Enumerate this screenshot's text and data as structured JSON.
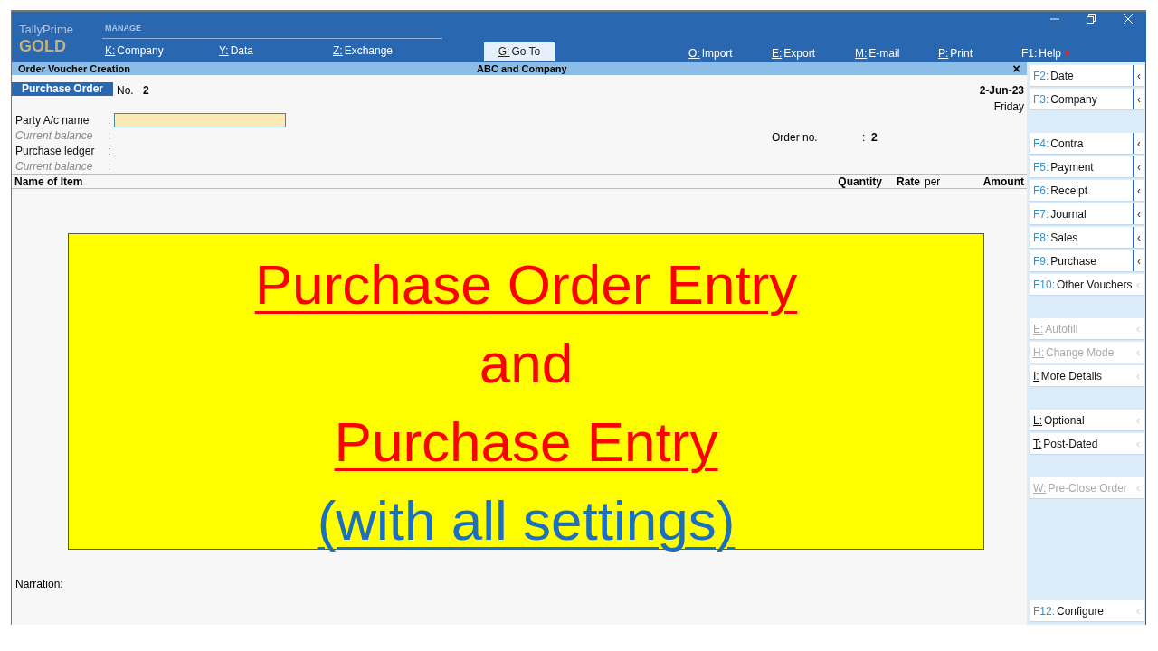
{
  "header": {
    "product": "TallyPrime",
    "edition": "GOLD",
    "section": "MANAGE",
    "menu": [
      {
        "key": "K:",
        "label": "Company"
      },
      {
        "key": "Y:",
        "label": "Data"
      },
      {
        "key": "Z:",
        "label": "Exchange"
      }
    ],
    "goto": {
      "key": "G:",
      "label": "Go To"
    },
    "right_menu": [
      {
        "key": "O:",
        "label": "Import",
        "kind": "letter"
      },
      {
        "key": "E:",
        "label": "Export",
        "kind": "letter"
      },
      {
        "key": "M:",
        "label": "E-mail",
        "kind": "letter"
      },
      {
        "key": "P:",
        "label": "Print",
        "kind": "letter"
      },
      {
        "key": "F1:",
        "label": "Help",
        "kind": "function"
      }
    ]
  },
  "title_bar": {
    "title": "Order Voucher Creation",
    "company": "ABC and Company",
    "close": "×"
  },
  "voucher": {
    "type": "Purchase Order",
    "no_label": "No.",
    "no": "2",
    "date": "2-Jun-23",
    "day": "Friday"
  },
  "fields": [
    {
      "label": "Party A/c name",
      "sep": ":",
      "kind": "input",
      "italic": false
    },
    {
      "label": "Current balance",
      "sep": ":",
      "kind": "info",
      "italic": true
    },
    {
      "label": "Purchase ledger",
      "sep": ":",
      "kind": "info",
      "italic": false
    },
    {
      "label": "Current balance",
      "sep": ":",
      "kind": "info",
      "italic": true
    }
  ],
  "order_no": {
    "label": "Order no.",
    "sep": ":",
    "value": "2"
  },
  "columns": [
    "Name of Item",
    "Quantity",
    "Rate",
    "per",
    "Amount"
  ],
  "banner": [
    {
      "text": "Purchase Order Entry",
      "color": "#ff0000",
      "underline": true
    },
    {
      "text": "and",
      "color": "#ff0000",
      "underline": false
    },
    {
      "text": "Purchase Entry",
      "color": "#ff0000",
      "underline": true
    },
    {
      "text": "(with all settings)",
      "color": "#1a6fc0",
      "underline": true
    }
  ],
  "narration": "Narration:",
  "sidebar": {
    "groups": [
      [
        {
          "key": "F2:",
          "label": "Date",
          "kind": "function",
          "disabled": false,
          "expandable": true,
          "arrow": "‹"
        },
        {
          "key": "F3:",
          "label": "Company",
          "kind": "function",
          "disabled": false,
          "expandable": true,
          "arrow": "‹"
        }
      ],
      [
        {
          "key": "F4:",
          "label": "Contra",
          "kind": "function",
          "disabled": false,
          "expandable": true,
          "arrow": "‹"
        },
        {
          "key": "F5:",
          "label": "Payment",
          "kind": "function",
          "disabled": false,
          "expandable": true,
          "arrow": "‹"
        },
        {
          "key": "F6:",
          "label": "Receipt",
          "kind": "function",
          "disabled": false,
          "expandable": true,
          "arrow": "‹"
        },
        {
          "key": "F7:",
          "label": "Journal",
          "kind": "function",
          "disabled": false,
          "expandable": true,
          "arrow": "‹"
        },
        {
          "key": "F8:",
          "label": "Sales",
          "kind": "function",
          "disabled": false,
          "expandable": true,
          "arrow": "‹"
        },
        {
          "key": "F9:",
          "label": "Purchase",
          "kind": "function",
          "disabled": false,
          "expandable": true,
          "arrow": "‹"
        },
        {
          "key": "F10:",
          "label": "Other Vouchers",
          "kind": "function",
          "disabled": false,
          "expandable": false,
          "arrow": "‹"
        }
      ],
      [
        {
          "key": "E:",
          "label": "Autofill",
          "kind": "letter",
          "disabled": true,
          "expandable": false,
          "arrow": "‹"
        },
        {
          "key": "H:",
          "label": "Change Mode",
          "kind": "letter",
          "disabled": true,
          "expandable": false,
          "arrow": "‹"
        },
        {
          "key": "I:",
          "label": "More Details",
          "kind": "letter",
          "disabled": false,
          "expandable": false,
          "arrow": "‹"
        }
      ],
      [
        {
          "key": "L:",
          "label": "Optional",
          "kind": "letter",
          "disabled": false,
          "expandable": false,
          "arrow": "‹"
        },
        {
          "key": "T:",
          "label": "Post-Dated",
          "kind": "letter",
          "disabled": false,
          "expandable": false,
          "arrow": "‹"
        }
      ],
      [
        {
          "key": "W:",
          "label": "Pre-Close Order",
          "kind": "letter",
          "disabled": true,
          "expandable": false,
          "arrow": "‹"
        }
      ]
    ],
    "bottom": [
      {
        "key": "F12:",
        "label": "Configure",
        "kind": "function",
        "disabled": false,
        "expandable": false,
        "arrow": "‹"
      }
    ]
  }
}
